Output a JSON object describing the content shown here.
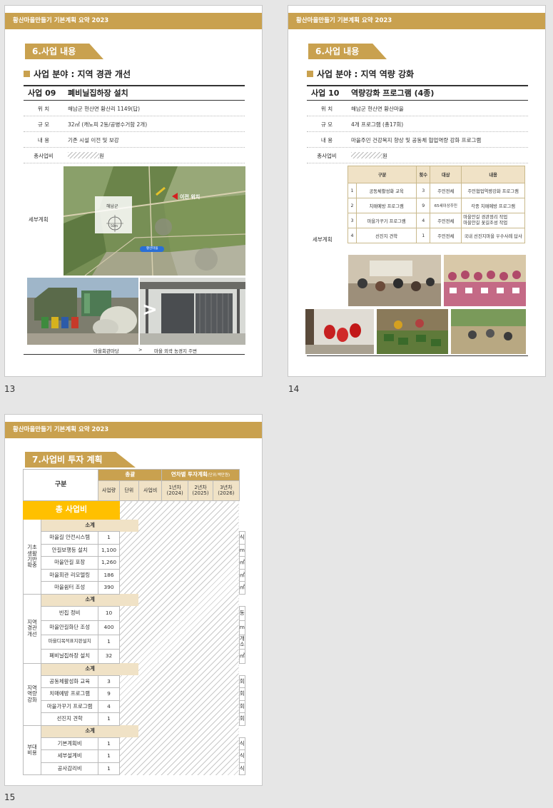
{
  "header_text": "황산마을만들기 기본계획 요약  2023",
  "slide13": {
    "page_number": "13",
    "section": "6.사업 내용",
    "subtitle": "사업 분야 : 지역 경관 개선",
    "project_no": "사업 09",
    "project_name": "폐비닐집하장 설치",
    "rows": [
      {
        "label": "위    치",
        "value": "해남군 현산면 황산리 1149(답)"
      },
      {
        "label": "규    모",
        "value": "32㎡ (캐노피 2동/공병수거함 2개)"
      },
      {
        "label": "내    용",
        "value": "기존 시설 이전 및 보강"
      },
      {
        "label": "총사업비",
        "value": "원"
      }
    ],
    "detail_label": "세부계획",
    "map_labels": {
      "marker": "이전 위치",
      "county": "해남군",
      "scale": "50m",
      "place": "황산마을"
    },
    "caption_left": "마을회관마당",
    "caption_arrow": ">",
    "caption_right": "마을 외곽 농경지 주변",
    "arrow_symbol": ">"
  },
  "slide14": {
    "page_number": "14",
    "section": "6.사업 내용",
    "subtitle": "사업 분야 : 지역 역량 강화",
    "project_no": "사업 10",
    "project_name": "역량강화 프로그램 (4종)",
    "rows": [
      {
        "label": "위    치",
        "value": "해남군 현산면 황산마을"
      },
      {
        "label": "규    모",
        "value": "4개 프로그램 (총17회)"
      },
      {
        "label": "내    용",
        "value": "마을주민 건강복지 향상 및 공동체 협업역량 강화 프로그램"
      },
      {
        "label": "총사업비",
        "value": "원"
      }
    ],
    "detail_label": "세부계획",
    "program_headers": [
      "구분",
      "횟수",
      "대상",
      "내용"
    ],
    "programs": [
      {
        "no": "1",
        "name": "공동체활성화 교육",
        "count": "3",
        "target": "주민전체",
        "content": "주민협업역량강화 프로그램"
      },
      {
        "no": "2",
        "name": "치매예방 프로그램",
        "count": "9",
        "target": "65세이상주민",
        "content": "각종 치매예방 프로그램"
      },
      {
        "no": "3",
        "name": "마을가꾸기 프로그램",
        "count": "4",
        "target": "주민전체",
        "content": "마을안길 경관정리 작업\n마을안길 꽃길조성 작업"
      },
      {
        "no": "4",
        "name": "선진지 견학",
        "count": "1",
        "target": "주민전체",
        "content": "국내 선진지마을 우수사례 답사"
      }
    ]
  },
  "slide15": {
    "page_number": "15",
    "section": "7.사업비 투자 계획",
    "col_group_label": "구분",
    "total_label": "총괄",
    "yearly_label": "연차별 투자계획",
    "yearly_unit": "(단위:백만원)",
    "sub_headers": [
      "사업량",
      "단위",
      "사업비"
    ],
    "years": [
      {
        "label": "1년차",
        "year": "(2024)"
      },
      {
        "label": "2년차",
        "year": "(2025)"
      },
      {
        "label": "3년차",
        "year": "(2026)"
      }
    ],
    "grand_total_label": "총 사업비",
    "subtotal_label": "소계",
    "groups": [
      {
        "name": "기초\n생활\n기반\n확충",
        "items": [
          {
            "name": "마을길 안전시스템",
            "qty": "1",
            "unit": "식"
          },
          {
            "name": "안길보행등 설치",
            "qty": "1,100",
            "unit": "m"
          },
          {
            "name": "마을안길 포장",
            "qty": "1,260",
            "unit": "㎡"
          },
          {
            "name": "마을회관 리모델링",
            "qty": "186",
            "unit": "㎡"
          },
          {
            "name": "마을쉼터 조성",
            "qty": "390",
            "unit": "㎡"
          }
        ]
      },
      {
        "name": "지역\n경관\n개선",
        "items": [
          {
            "name": "빈집 정비",
            "qty": "10",
            "unit": "동"
          },
          {
            "name": "마을안길화단 조성",
            "qty": "400",
            "unit": "m"
          },
          {
            "name": "마을디목적표지판설치",
            "qty": "1",
            "unit": "개소"
          },
          {
            "name": "폐비닐집하장 설치",
            "qty": "32",
            "unit": "㎡"
          }
        ]
      },
      {
        "name": "지역\n역량\n강화",
        "items": [
          {
            "name": "공동체활성화 교육",
            "qty": "3",
            "unit": "회"
          },
          {
            "name": "치매예방 프로그램",
            "qty": "9",
            "unit": "회"
          },
          {
            "name": "마을가꾸기 프로그램",
            "qty": "4",
            "unit": "회"
          },
          {
            "name": "선진지 견학",
            "qty": "1",
            "unit": "회"
          }
        ]
      },
      {
        "name": "부대\n비용",
        "items": [
          {
            "name": "기본계획비",
            "qty": "1",
            "unit": "식"
          },
          {
            "name": "세부설계비",
            "qty": "1",
            "unit": "식"
          },
          {
            "name": "공사감리비",
            "qty": "1",
            "unit": "식"
          }
        ]
      }
    ]
  },
  "colors": {
    "gold": "#c9a14f",
    "cream": "#f0e2c6",
    "yellow": "#ffc000"
  }
}
